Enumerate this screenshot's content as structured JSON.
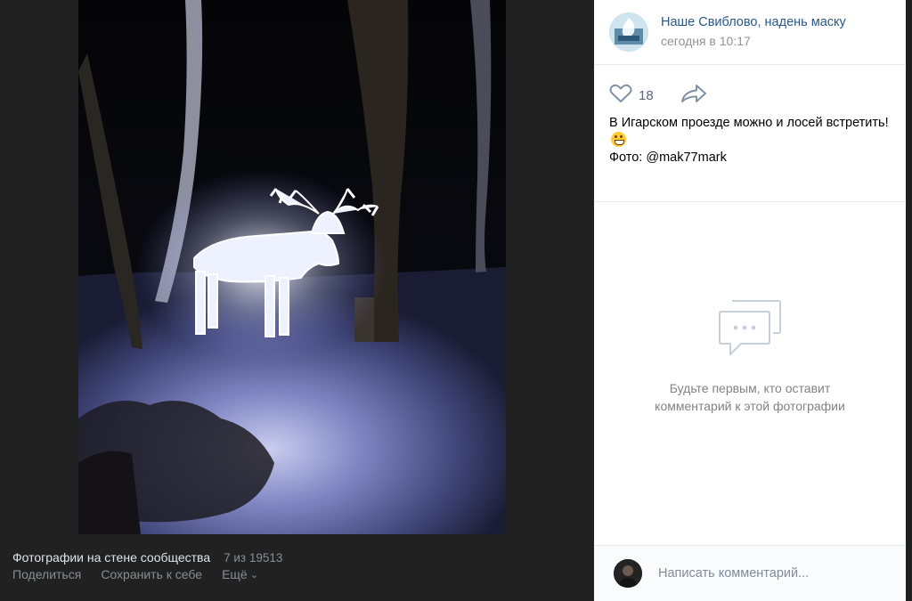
{
  "viewer": {
    "album_title": "Фотографии на стене сообщества",
    "counter": "7 из 19513",
    "actions": {
      "share": "Поделиться",
      "save": "Сохранить к себе",
      "more": "Ещё"
    }
  },
  "post": {
    "group_name": "Наше Свиблово, надень маску",
    "time": "сегодня в 10:17",
    "likes": "18",
    "text_line": "В Игарском проезде можно и лосей встретить!",
    "credit": "Фото: @mak77mark"
  },
  "comments": {
    "empty_text": "Будьте первым, кто оставит комментарий к этой фотографии",
    "input_placeholder": "Написать комментарий..."
  },
  "icons": {
    "like": "heart-icon",
    "share": "share-arrow-icon",
    "empty_comments": "speech-bubble-icon",
    "more": "chevron-down-icon"
  },
  "colors": {
    "link": "#2a5885",
    "muted": "#939393",
    "viewer_bg": "#212121",
    "panel_bg": "#ffffff"
  }
}
